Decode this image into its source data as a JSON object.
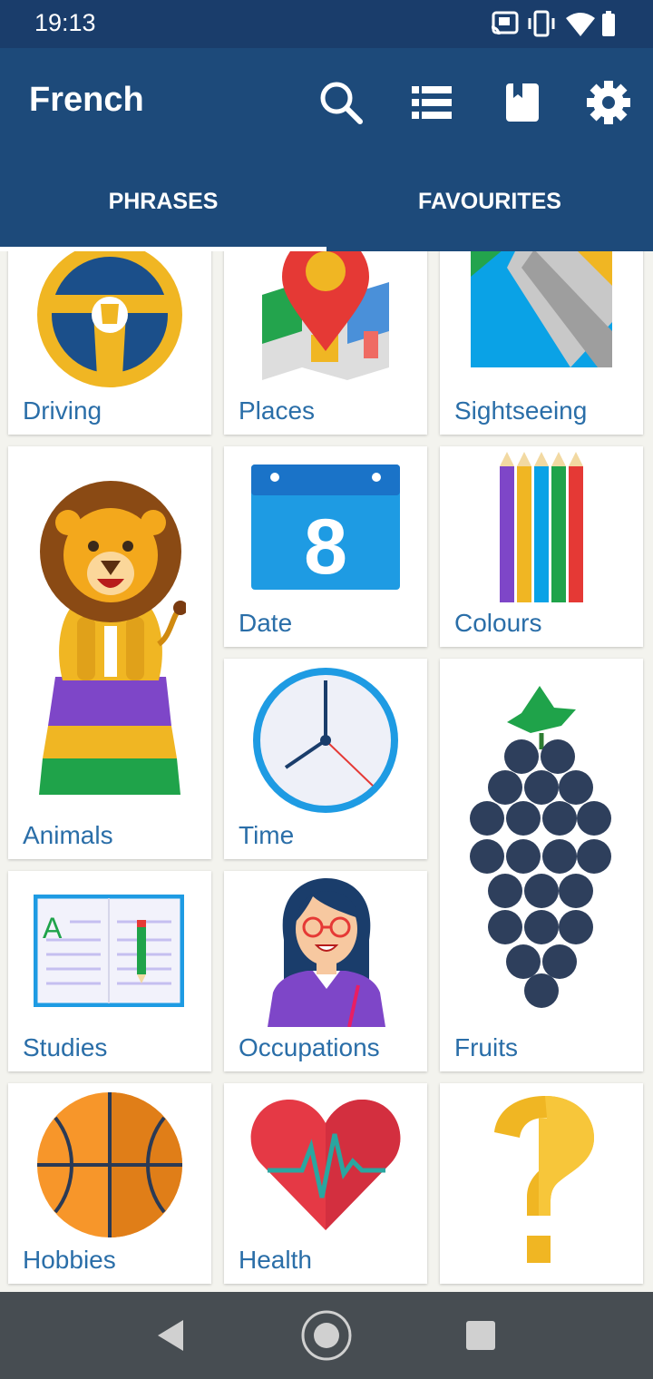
{
  "status_bar": {
    "time": "19:13",
    "icons": [
      "cast-icon",
      "vibrate-icon",
      "wifi-icon",
      "battery-icon"
    ]
  },
  "app_bar": {
    "title": "French",
    "actions": [
      "search-icon",
      "list-icon",
      "bookmark-icon",
      "gear-icon"
    ]
  },
  "tabs": [
    {
      "label": "PHRASES",
      "selected": true
    },
    {
      "label": "FAVOURITES",
      "selected": false
    }
  ],
  "categories": [
    {
      "label": "Driving",
      "icon": "steering-wheel-icon"
    },
    {
      "label": "Places",
      "icon": "map-pin-icon"
    },
    {
      "label": "Sightseeing",
      "icon": "map-icon"
    },
    {
      "label": "Animals",
      "icon": "lion-icon"
    },
    {
      "label": "Date",
      "icon": "calendar-icon",
      "calendar_number": "8"
    },
    {
      "label": "Colours",
      "icon": "pencils-icon"
    },
    {
      "label": "Time",
      "icon": "clock-icon"
    },
    {
      "label": "Fruits",
      "icon": "grapes-icon"
    },
    {
      "label": "Studies",
      "icon": "book-icon",
      "book_letter": "A"
    },
    {
      "label": "Occupations",
      "icon": "teacher-icon"
    },
    {
      "label": "Hobbies",
      "icon": "basketball-icon"
    },
    {
      "label": "Health",
      "icon": "heart-icon"
    },
    {
      "label": "",
      "icon": "question-mark-icon"
    }
  ],
  "nav_bar": [
    "back-icon",
    "home-icon",
    "recents-icon"
  ],
  "colors": {
    "status_bar": "#1a3d6b",
    "app_bar": "#1d4a7a",
    "label": "#2a6ea8",
    "background": "#f3f3ee"
  }
}
